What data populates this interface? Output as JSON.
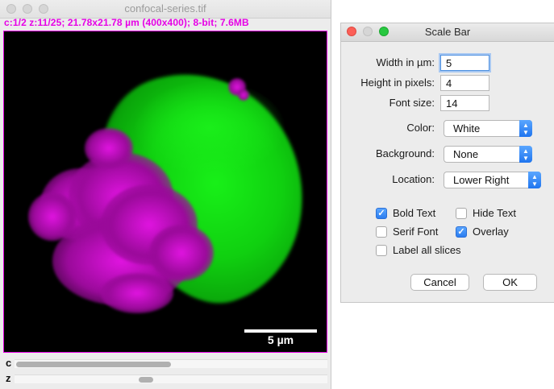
{
  "image_window": {
    "title": "confocal-series.tif",
    "info": "c:1/2 z:11/25; 21.78x21.78 µm (400x400); 8-bit; 7.6MB",
    "scale_bar_label": "5 µm",
    "channel_slider_label": "c",
    "z_slider_label": "z",
    "channel_position": "1/2",
    "z_position": "11/25"
  },
  "dialog": {
    "title": "Scale Bar",
    "width_label": "Width in µm:",
    "width_value": "5",
    "height_label": "Height in pixels:",
    "height_value": "4",
    "font_label": "Font size:",
    "font_value": "14",
    "color_label": "Color:",
    "color_value": "White",
    "background_label": "Background:",
    "background_value": "None",
    "location_label": "Location:",
    "location_value": "Lower Right",
    "checkboxes": {
      "bold_text": {
        "label": "Bold Text",
        "checked": true
      },
      "hide_text": {
        "label": "Hide Text",
        "checked": false
      },
      "serif_font": {
        "label": "Serif Font",
        "checked": false
      },
      "overlay": {
        "label": "Overlay",
        "checked": true
      },
      "label_all_slices": {
        "label": "Label all slices",
        "checked": false
      }
    },
    "cancel_label": "Cancel",
    "ok_label": "OK"
  },
  "colors": {
    "info_text": "#e600e6",
    "green_channel": "#10d010",
    "magenta_channel": "#e014e0",
    "accent_blue": "#2b7df0"
  },
  "icons": {
    "close": "close-icon",
    "minimize": "minimize-icon",
    "zoom": "zoom-icon",
    "select_caret": "chevron-updown-icon",
    "checkmark": "checkmark-icon"
  }
}
